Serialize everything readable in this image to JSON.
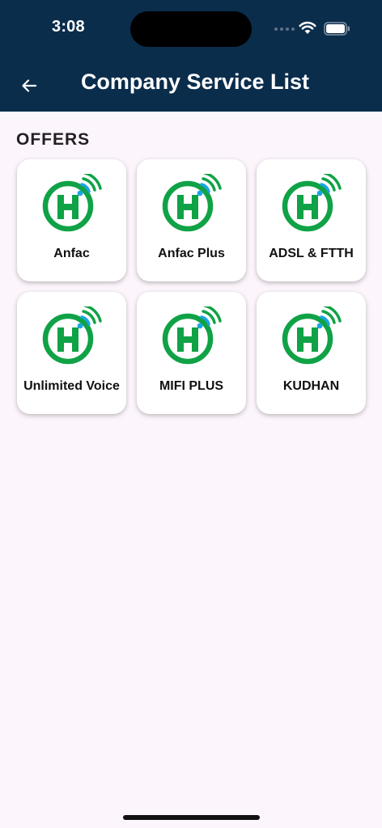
{
  "status_bar": {
    "time": "3:08"
  },
  "header": {
    "title": "Company Service List",
    "back_icon": "arrow-left-icon"
  },
  "section": {
    "title": "OFFERS"
  },
  "logo": {
    "icon": "h-wifi-logo-icon",
    "ring_color": "#10a246",
    "signal_color": "#1aa4e8"
  },
  "services": [
    {
      "label": "Anfac"
    },
    {
      "label": "Anfac Plus"
    },
    {
      "label": "ADSL & FTTH"
    },
    {
      "label": "Unlimited Voice"
    },
    {
      "label": "MIFI PLUS"
    },
    {
      "label": "KUDHAN"
    }
  ]
}
